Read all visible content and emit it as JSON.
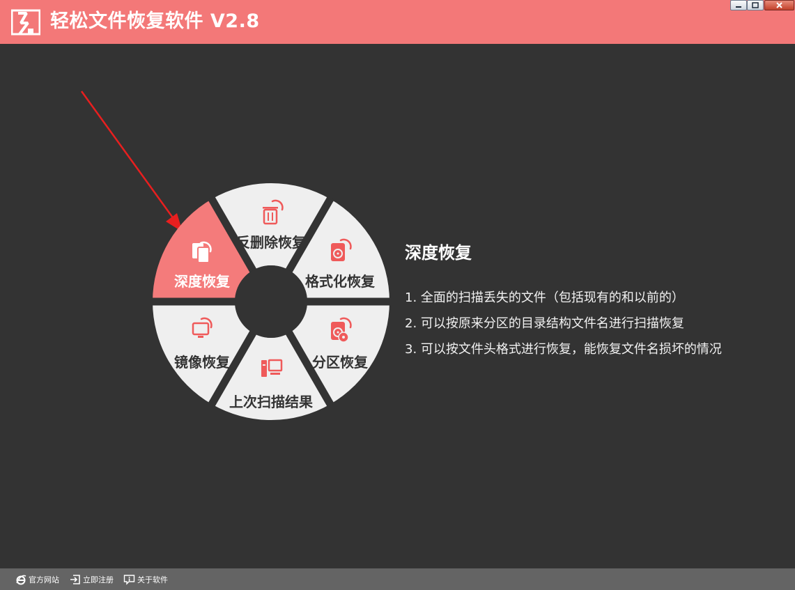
{
  "window": {
    "title": "轻松文件恢复软件 V2.8",
    "accent_color": "#f37878",
    "background_color": "#333333",
    "controls": [
      "minimize-icon",
      "maximize-icon",
      "close-icon"
    ]
  },
  "menu": {
    "active_color": "#f47b7b",
    "inactive_color": "#efefef",
    "icon_color": "#ef5a5a",
    "center_color": "#333333",
    "items": [
      {
        "label": "深度恢复",
        "icon": "deep-recovery-icon",
        "active": true
      },
      {
        "label": "反删除恢复",
        "icon": "trash-restore-icon",
        "active": false
      },
      {
        "label": "格式化恢复",
        "icon": "disk-format-icon",
        "active": false
      },
      {
        "label": "分区恢复",
        "icon": "partition-disk-icon",
        "active": false
      },
      {
        "label": "上次扫描结果",
        "icon": "computer-icon",
        "active": false
      },
      {
        "label": "镜像恢复",
        "icon": "monitor-image-icon",
        "active": false
      }
    ]
  },
  "detail": {
    "title": "深度恢复",
    "lines": [
      "1. 全面的扫描丢失的文件（包括现有的和以前的）",
      "2. 可以按原来分区的目录结构文件名进行扫描恢复",
      "3. 可以按文件头格式进行恢复，能恢复文件名损坏的情况"
    ]
  },
  "statusbar": {
    "links": [
      {
        "label": "官方网站",
        "icon": "ie-browser-icon"
      },
      {
        "label": "立即注册",
        "icon": "register-icon"
      },
      {
        "label": "关于软件",
        "icon": "info-icon"
      }
    ]
  }
}
